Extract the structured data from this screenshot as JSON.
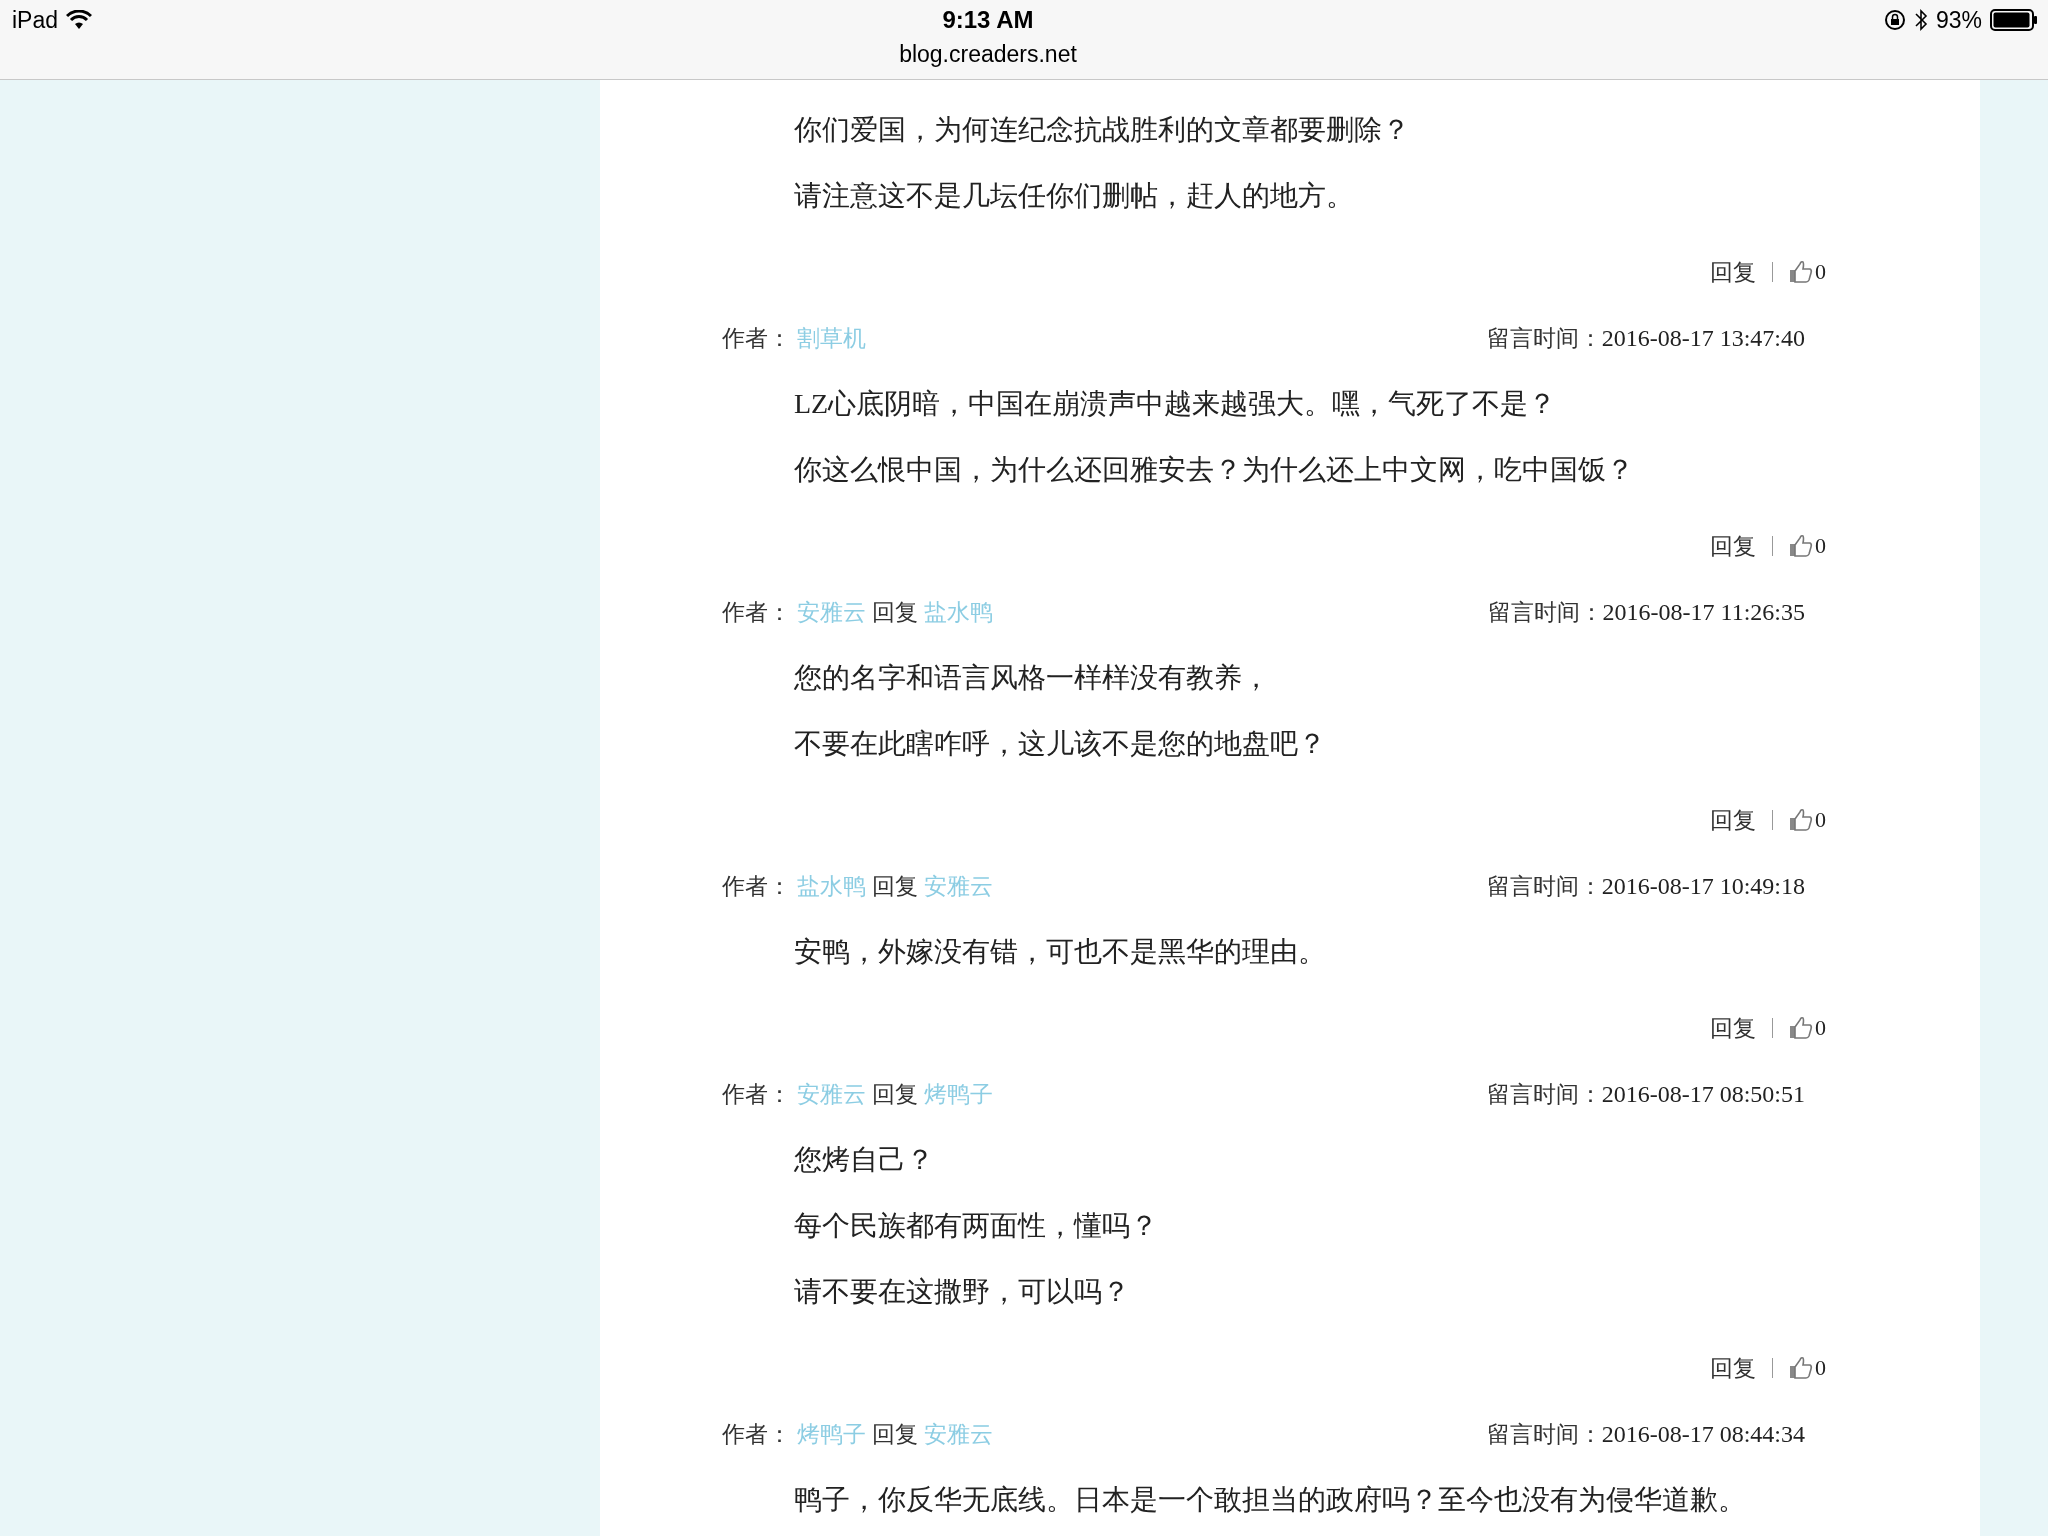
{
  "status_bar": {
    "device": "iPad",
    "time": "9:13 AM",
    "url": "blog.creaders.net",
    "battery": "93%"
  },
  "comments": [
    {
      "lines": [
        "你们爱国，为何连纪念抗战胜利的文章都要删除？",
        "请注意这不是几坛任你们删帖，赶人的地方。"
      ],
      "reply": "回复",
      "likes": "0"
    },
    {
      "author_label": "作者：",
      "author": "割草机",
      "time_label": "留言时间：",
      "time": "2016-08-17 13:47:40",
      "lines": [
        "LZ心底阴暗，中国在崩溃声中越来越强大。嘿，气死了不是？",
        "你这么恨中国，为什么还回雅安去？为什么还上中文网，吃中国饭？"
      ],
      "reply": "回复",
      "likes": "0"
    },
    {
      "author_label": "作者：",
      "author": "安雅云",
      "reply_word": "回复",
      "reply_to": "盐水鸭",
      "time_label": "留言时间：",
      "time": "2016-08-17 11:26:35",
      "lines": [
        "您的名字和语言风格一样样没有教养，",
        "不要在此瞎咋呼，这儿该不是您的地盘吧？"
      ],
      "reply": "回复",
      "likes": "0"
    },
    {
      "author_label": "作者：",
      "author": "盐水鸭",
      "reply_word": "回复",
      "reply_to": "安雅云",
      "time_label": "留言时间：",
      "time": "2016-08-17 10:49:18",
      "lines": [
        "安鸭，外嫁没有错，可也不是黑华的理由。"
      ],
      "reply": "回复",
      "likes": "0"
    },
    {
      "author_label": "作者：",
      "author": "安雅云",
      "reply_word": "回复",
      "reply_to": "烤鸭子",
      "time_label": "留言时间：",
      "time": "2016-08-17 08:50:51",
      "lines": [
        "您烤自己？",
        "每个民族都有两面性，懂吗？",
        "请不要在这撒野，可以吗？"
      ],
      "reply": "回复",
      "likes": "0"
    },
    {
      "author_label": "作者：",
      "author": "烤鸭子",
      "reply_word": "回复",
      "reply_to": "安雅云",
      "time_label": "留言时间：",
      "time": "2016-08-17 08:44:34",
      "lines": [
        "鸭子，你反华无底线。日本是一个敢担当的政府吗？至今也没有为侵华道歉。"
      ]
    }
  ]
}
